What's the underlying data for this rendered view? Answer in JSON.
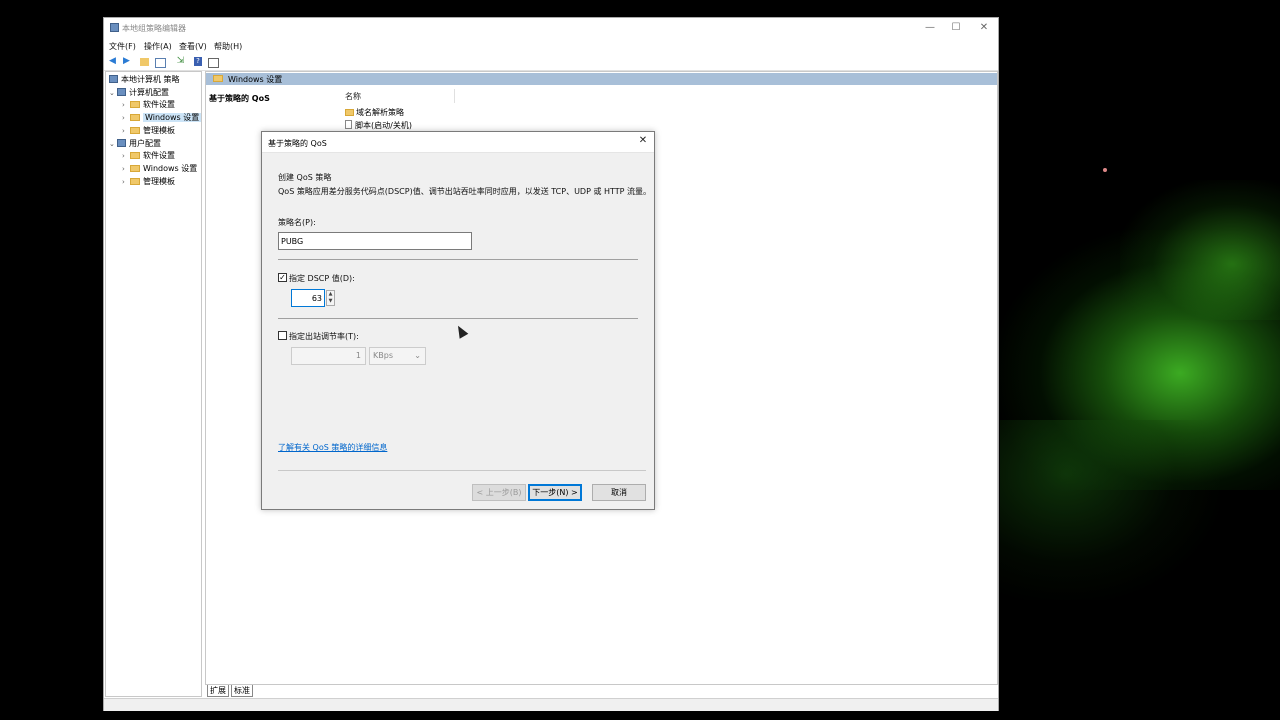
{
  "window": {
    "title": "本地组策略编辑器",
    "controls": {
      "minimize": "—",
      "maximize": "☐",
      "close": "✕"
    }
  },
  "menu": [
    "文件(F)",
    "操作(A)",
    "查看(V)",
    "帮助(H)"
  ],
  "tree": {
    "root": "本地计算机 策略",
    "computer_config": "计算机配置",
    "cc_items": [
      "软件设置",
      "Windows 设置",
      "管理模板"
    ],
    "user_config": "用户配置",
    "uc_items": [
      "软件设置",
      "Windows 设置",
      "管理模板"
    ]
  },
  "right_pane": {
    "header": "Windows 设置",
    "left_title": "基于策略的 QoS",
    "column_name": "名称",
    "items": [
      "域名解析策略",
      "脚本(启动/关机)"
    ]
  },
  "bottom_tabs": [
    "扩展",
    "标准"
  ],
  "dialog": {
    "title": "基于策略的 QoS",
    "heading": "创建 QoS 策略",
    "description": "QoS 策略应用差分服务代码点(DSCP)值、调节出站吞吐率同时应用，以发送 TCP、UDP 或 HTTP 流量。",
    "policy_name_label": "策略名(P):",
    "policy_name_value": "PUBG",
    "dscp_label": "指定 DSCP 值(D):",
    "dscp_checked": true,
    "dscp_value": "63",
    "throttle_label": "指定出站调节率(T):",
    "throttle_checked": false,
    "throttle_value": "1",
    "throttle_unit": "KBps",
    "link": "了解有关 QoS 策略的详细信息",
    "buttons": {
      "back": "< 上一步(B)",
      "next": "下一步(N) >",
      "cancel": "取消"
    }
  }
}
